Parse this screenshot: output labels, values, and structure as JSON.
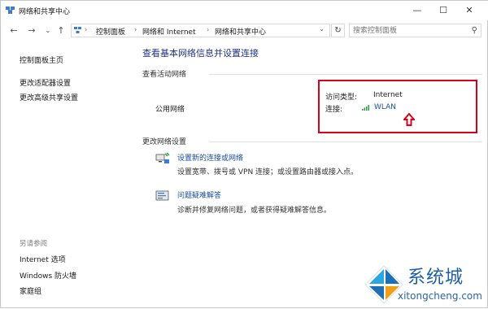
{
  "window": {
    "title": "网络和共享中心"
  },
  "nav": {
    "breadcrumbs": [
      "控制面板",
      "网络和 Internet",
      "网络和共享中心"
    ],
    "search_placeholder": "搜索控制面板"
  },
  "sidebar": {
    "items": [
      "控制面板主页",
      "更改适配器设置",
      "更改高级共享设置"
    ],
    "see_also_label": "另请参阅",
    "see_also": [
      "Internet 选项",
      "Windows 防火墙",
      "家庭组"
    ]
  },
  "main": {
    "heading": "查看基本网络信息并设置连接",
    "active_networks_label": "查看活动网络",
    "network_name": "公用网络",
    "access_type_label": "访问类型:",
    "access_type_value": "Internet",
    "connection_label": "连接:",
    "connection_value": "WLAN",
    "change_settings_label": "更改网络设置",
    "tasks": [
      {
        "title": "设置新的连接或网络",
        "desc": "设置宽带、拨号或 VPN 连接；或设置路由器或接入点。"
      },
      {
        "title": "问题疑难解答",
        "desc": "诊断并修复网络问题，或者获得疑难解答信息。"
      }
    ]
  },
  "watermark": {
    "brand": "系统城",
    "url": "xitongcheng.com"
  },
  "colors": {
    "link": "#1a4fa3",
    "heading": "#1e3287",
    "highlight": "#d9001b"
  }
}
